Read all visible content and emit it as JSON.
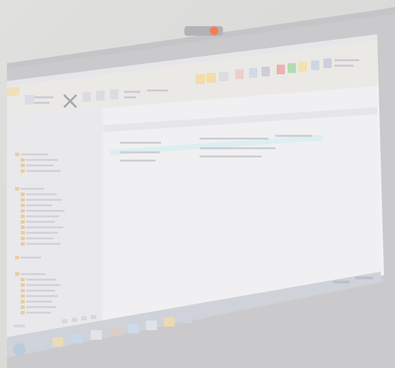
{
  "scene": {
    "description_tag": "photo-of-monitor-running-email-client",
    "colors": {
      "wall": "#d6d6d4",
      "bezel": "#c4c4c6",
      "screen": "#ececef",
      "ribbon": "#e7e5e2",
      "ribbon_accent": "#eedcb0",
      "sidebar": "#e6e6ea",
      "selected_row": "#d9ecee",
      "taskbar": "#c9ccd4",
      "webcam_led": "#ff5a2a"
    },
    "icons": [
      "webcam-icon",
      "start-orb-icon",
      "explorer-icon",
      "browser-icon",
      "mail-app-icon",
      "folder-icon",
      "task-icon",
      "calendar-icon"
    ]
  },
  "screen": {
    "sidebar_folders_count_visible": 24,
    "message_rows_count_visible": 3
  }
}
